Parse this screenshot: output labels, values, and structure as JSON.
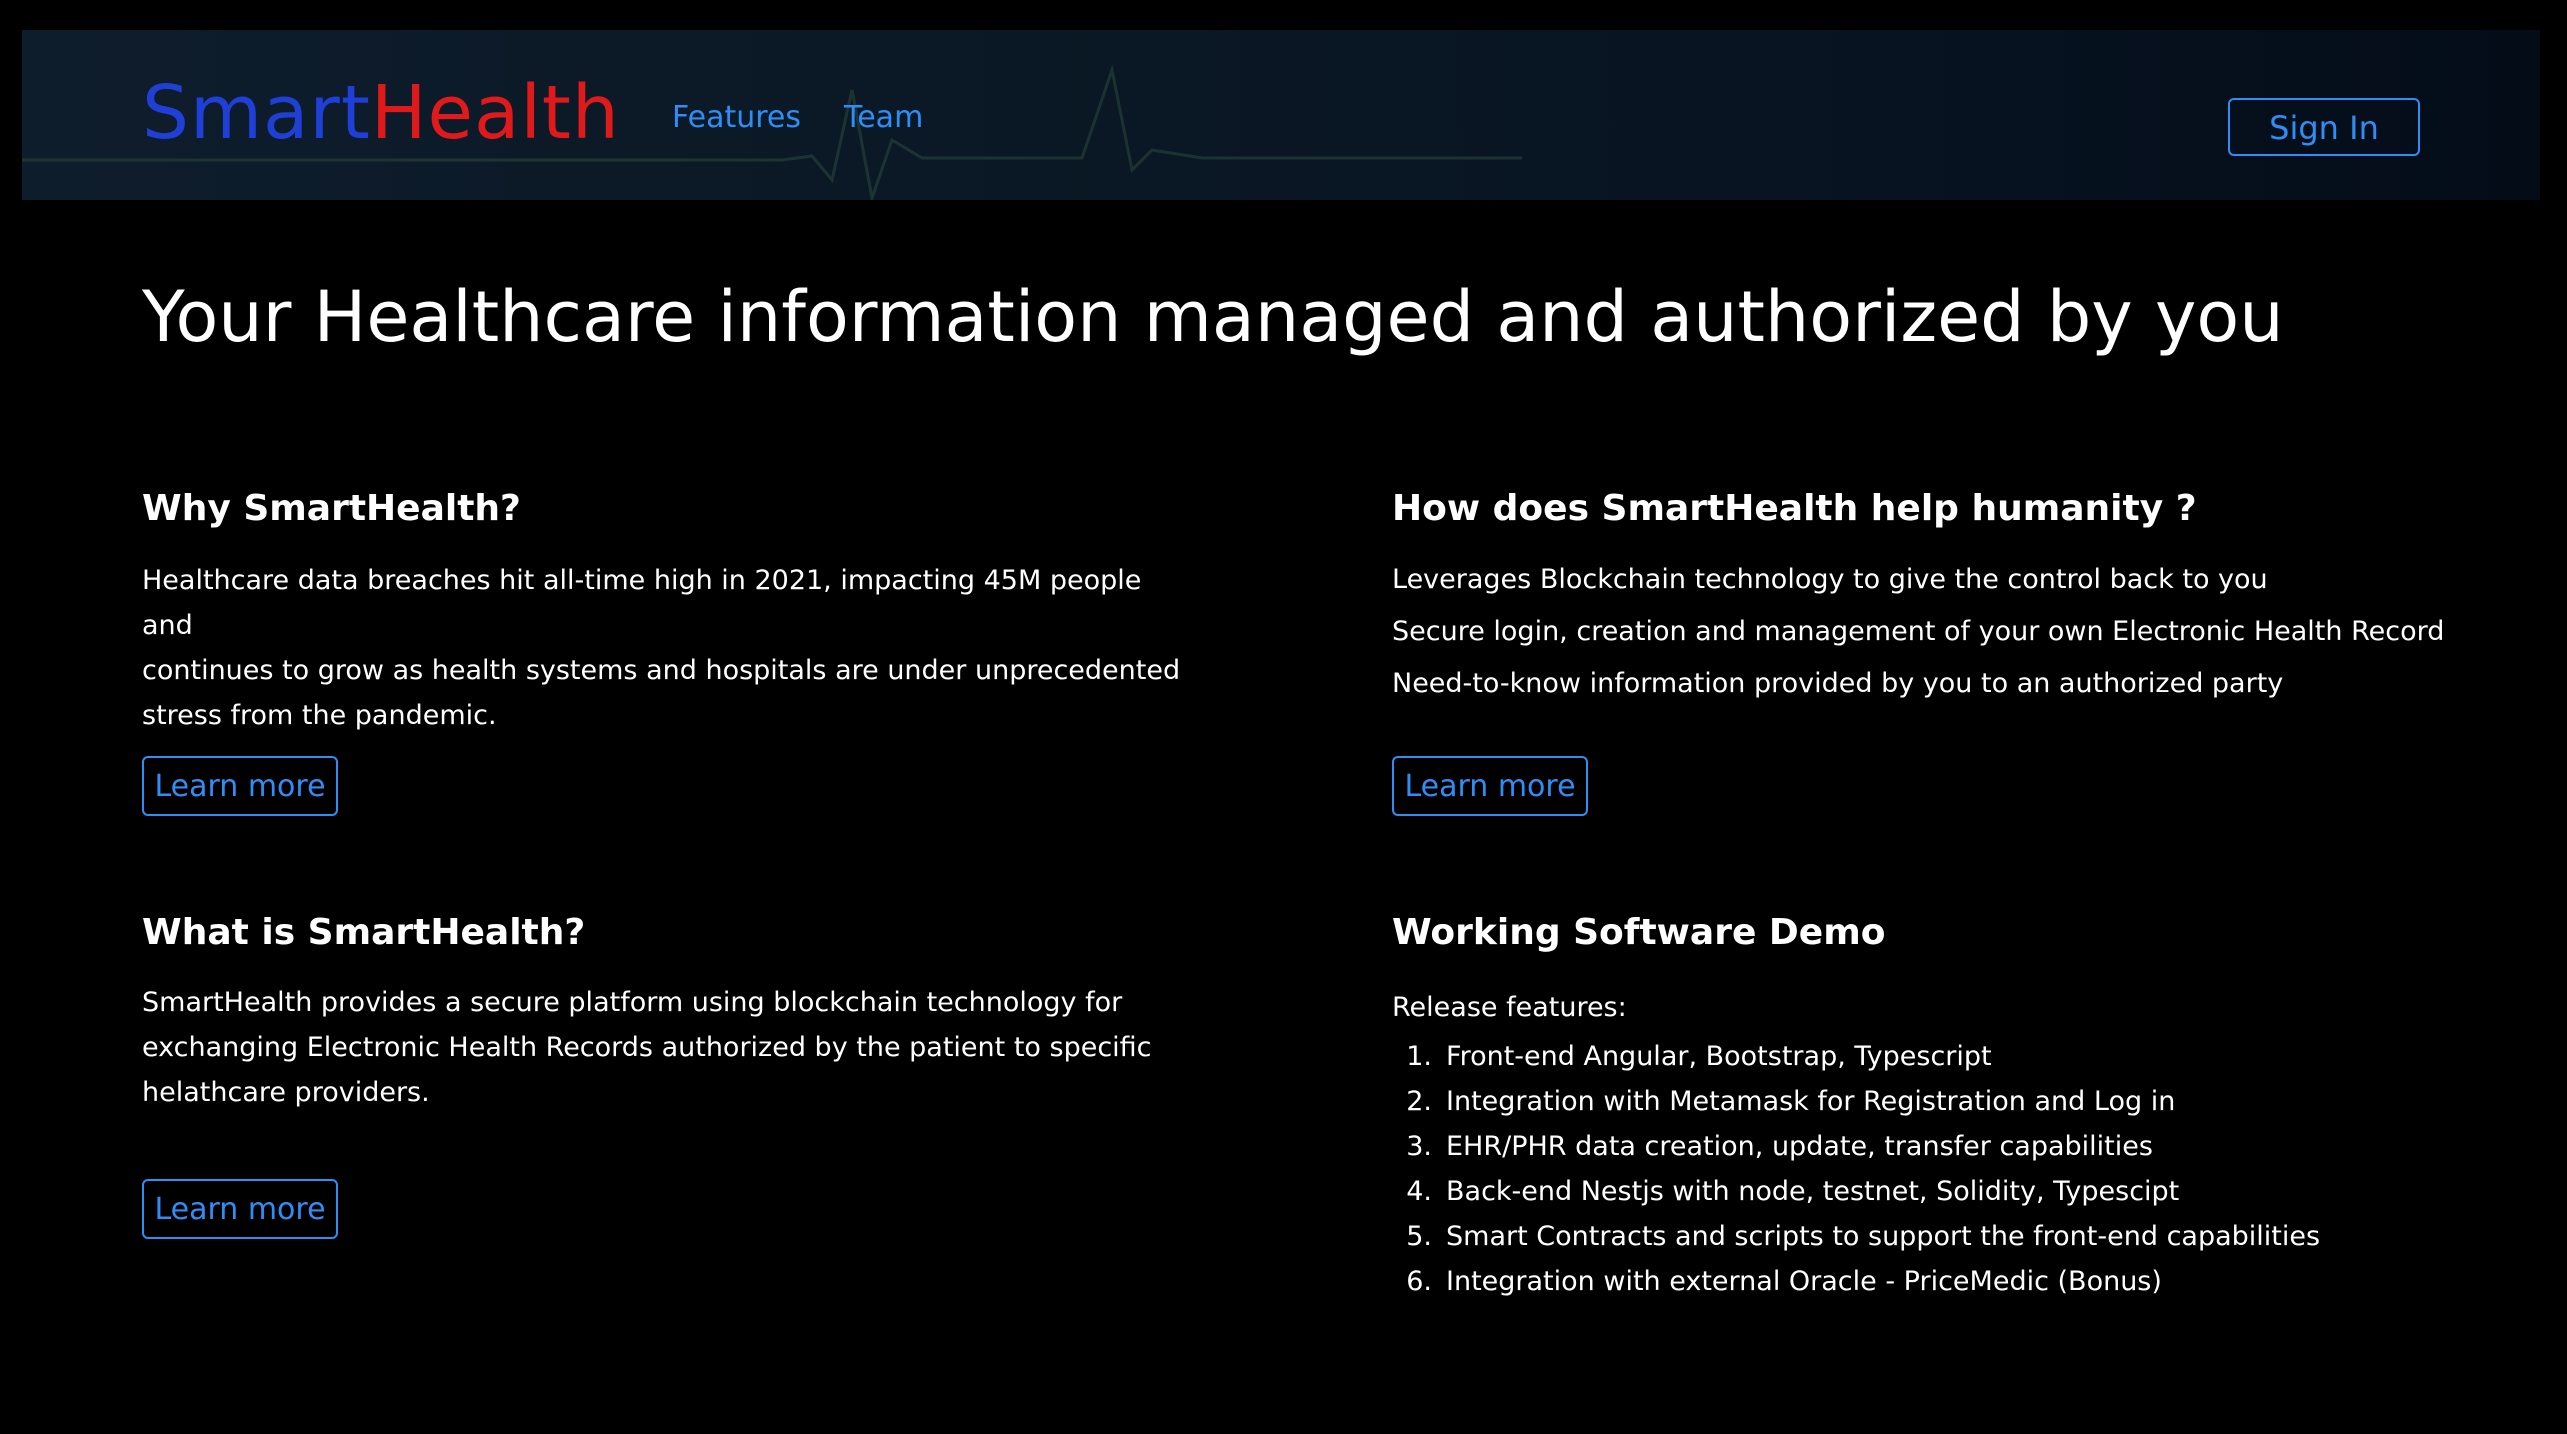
{
  "brand": {
    "part1": "Smart",
    "part2": "Health",
    "color1": "#1f3fd6",
    "color2": "#e01a1a"
  },
  "nav": {
    "links": [
      {
        "label": "Features"
      },
      {
        "label": "Team"
      }
    ],
    "signin_label": "Sign In",
    "link_color": "#2f8ef5"
  },
  "hero": {
    "title": "Your Healthcare information managed and authorized by you"
  },
  "sections": {
    "why": {
      "heading": "Why SmartHealth?",
      "lines": [
        "Healthcare data breaches hit all-time high in 2021, impacting 45M people and",
        "continues to grow as health systems and hospitals are under unprecedented",
        "stress from the pandemic."
      ],
      "button": "Learn more"
    },
    "how": {
      "heading": "How does SmartHealth help humanity ?",
      "lines": [
        "Leverages Blockchain technology to give the control back to you",
        "Secure login, creation and management of your own Electronic Health Record",
        "Need-to-know information provided by you to an authorized party"
      ],
      "button": "Learn more"
    },
    "what": {
      "heading": "What is SmartHealth?",
      "lines": [
        "SmartHealth provides a secure platform using blockchain technology for",
        "exchanging Electronic Health Records authorized by the patient to specific",
        "helathcare providers."
      ],
      "button": "Learn more"
    },
    "demo": {
      "heading": "Working Software Demo",
      "intro": "Release features:",
      "items": [
        {
          "num": "1.",
          "text": "Front-end Angular, Bootstrap, Typescript"
        },
        {
          "num": "2.",
          "text": "Integration with Metamask for Registration and Log in"
        },
        {
          "num": "3.",
          "text": "EHR/PHR data creation, update, transfer capabilities"
        },
        {
          "num": "4.",
          "text": "Back-end Nestjs with node, testnet, Solidity, Typescipt"
        },
        {
          "num": "5.",
          "text": "Smart Contracts and scripts to support the front-end capabilities"
        },
        {
          "num": "6.",
          "text": "Integration with external Oracle - PriceMedic (Bonus)"
        }
      ]
    }
  }
}
